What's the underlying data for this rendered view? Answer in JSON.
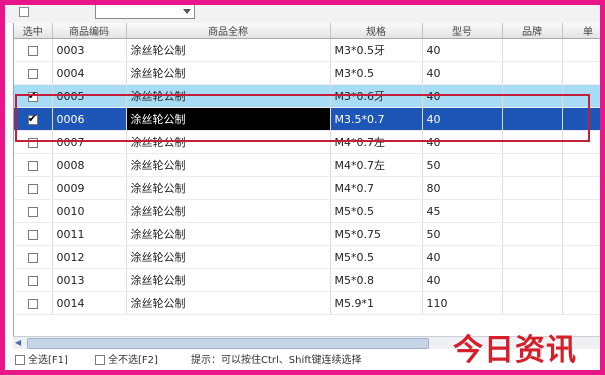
{
  "toolbar": {
    "combo_value": ""
  },
  "grid": {
    "columns": [
      "选中",
      "商品编码",
      "商品全称",
      "规格",
      "型号",
      "品牌",
      "单"
    ],
    "rows": [
      {
        "checked": false,
        "code": "0003",
        "name": "涂丝轮公制",
        "spec": "M3*0.5牙",
        "model": "40",
        "brand": "",
        "unit": "",
        "state": ""
      },
      {
        "checked": false,
        "code": "0004",
        "name": "涂丝轮公制",
        "spec": "M3*0.5",
        "model": "40",
        "brand": "",
        "unit": "",
        "state": ""
      },
      {
        "checked": true,
        "code": "0005",
        "name": "涂丝轮公制",
        "spec": "M3*0.6牙",
        "model": "40",
        "brand": "",
        "unit": "",
        "state": "hl1"
      },
      {
        "checked": true,
        "code": "0006",
        "name": "涂丝轮公制",
        "spec": "M3.5*0.7",
        "model": "40",
        "brand": "",
        "unit": "",
        "state": "hl2"
      },
      {
        "checked": false,
        "code": "0007",
        "name": "涂丝轮公制",
        "spec": "M4*0.7左",
        "model": "40",
        "brand": "",
        "unit": "",
        "state": ""
      },
      {
        "checked": false,
        "code": "0008",
        "name": "涂丝轮公制",
        "spec": "M4*0.7左",
        "model": "50",
        "brand": "",
        "unit": "",
        "state": ""
      },
      {
        "checked": false,
        "code": "0009",
        "name": "涂丝轮公制",
        "spec": "M4*0.7",
        "model": "80",
        "brand": "",
        "unit": "",
        "state": ""
      },
      {
        "checked": false,
        "code": "0010",
        "name": "涂丝轮公制",
        "spec": "M5*0.5",
        "model": "45",
        "brand": "",
        "unit": "",
        "state": ""
      },
      {
        "checked": false,
        "code": "0011",
        "name": "涂丝轮公制",
        "spec": "M5*0.75",
        "model": "50",
        "brand": "",
        "unit": "",
        "state": ""
      },
      {
        "checked": false,
        "code": "0012",
        "name": "涂丝轮公制",
        "spec": "M5*0.5",
        "model": "40",
        "brand": "",
        "unit": "",
        "state": ""
      },
      {
        "checked": false,
        "code": "0013",
        "name": "涂丝轮公制",
        "spec": "M5*0.8",
        "model": "40",
        "brand": "",
        "unit": "",
        "state": ""
      },
      {
        "checked": false,
        "code": "0014",
        "name": "涂丝轮公制",
        "spec": "M5.9*1",
        "model": "110",
        "brand": "",
        "unit": "",
        "state": ""
      }
    ]
  },
  "status": {
    "select_all": "全选[F1]",
    "select_none": "全不选[F2]",
    "hint": "提示：可以按住Ctrl、Shift键连续选择"
  },
  "watermark": "今日资讯",
  "colors": {
    "frame_border": "#e8168a",
    "row_highlight_light": "#a8dcf4",
    "row_highlight_dark": "#1e56b8",
    "selection_box": "#c21f3a",
    "watermark": "#d4202a"
  },
  "icons": {
    "scroll_left": "arrow-left-icon",
    "dropdown": "chevron-down-icon"
  }
}
